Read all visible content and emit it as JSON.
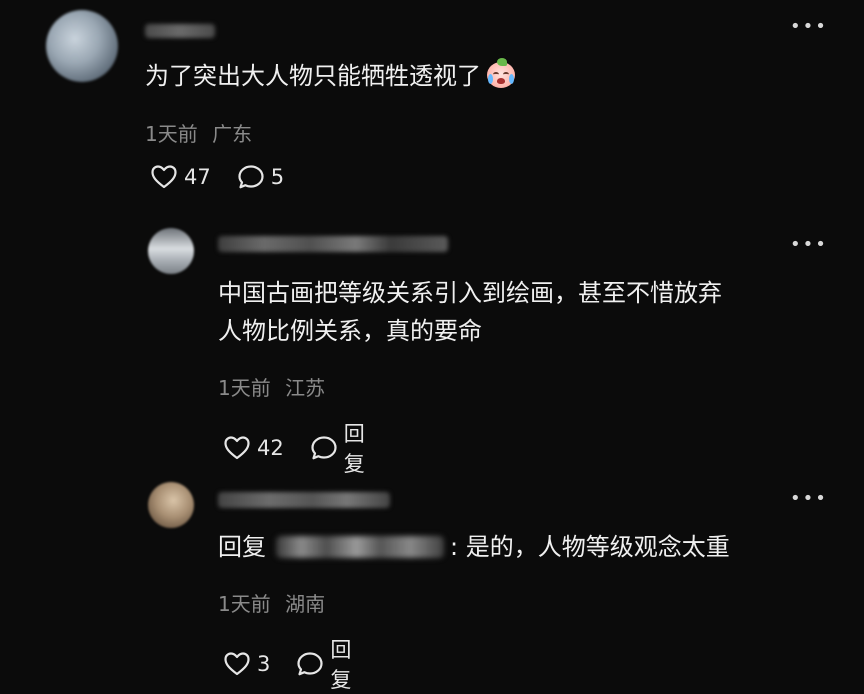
{
  "comments": [
    {
      "text": "为了突出大人物只能牺牲透视了",
      "emoji": "crying-face-emoji",
      "time": "1天前",
      "location": "广东",
      "likes": "47",
      "replies": "5"
    }
  ],
  "replies": [
    {
      "text_line1": "中国古画把等级关系引入到绘画，甚至不惜放弃",
      "text_line2": "人物比例关系，真的要命",
      "time": "1天前",
      "location": "江苏",
      "likes": "42",
      "reply_label": "回复"
    },
    {
      "reply_prefix": "回复",
      "text": ": 是的，人物等级观念太重",
      "time": "1天前",
      "location": "湖南",
      "likes": "3",
      "reply_label": "回复"
    }
  ],
  "more_icon": "more-horizontal-icon",
  "colors": {
    "background": "#0b0b0b",
    "text": "#f0f0f0",
    "meta": "#8a8a8a"
  }
}
